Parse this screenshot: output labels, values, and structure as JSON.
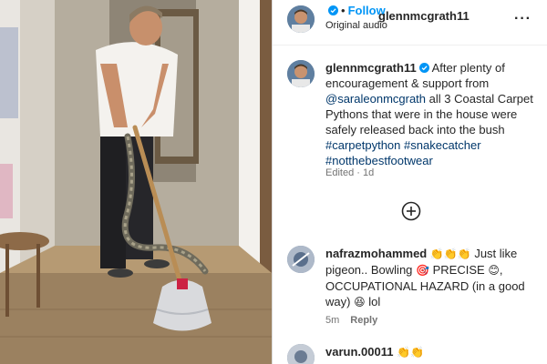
{
  "post": {
    "author": "glennmcgrath11",
    "follow_label": "Follow",
    "dot": "•",
    "audio": "Original audio",
    "more_icon": "more-options-icon",
    "caption": {
      "username": "glennmcgrath11",
      "text_1": "After plenty of encouragement & support from",
      "mention": "@saraleonmcgrath",
      "text_2": "all 3 Coastal Carpet Pythons that were in the house were safely released back into the bush",
      "hashtags": [
        "#carpetpython",
        "#snakecatcher",
        "#notthebestfootwear"
      ]
    },
    "meta": "Edited · 1d"
  },
  "comments": [
    {
      "username": "nafrazmohammed",
      "text_a": "Just like pigeon.. Bowling",
      "text_b": "PRECISE",
      "text_c": ", OCCUPATIONAL HAZARD (in a good way)",
      "text_d": "lol",
      "emoji_clap": "👏👏👏",
      "emoji_target": "🎯",
      "emoji_smile": "😊",
      "emoji_laugh": "😆",
      "time": "5m",
      "reply_label": "Reply"
    },
    {
      "username": "varun.00011",
      "emoji_clap": "👏👏"
    }
  ],
  "colors": {
    "follow": "#0095f6",
    "link": "#00376b",
    "muted": "#737373",
    "verified": "#0095f6"
  }
}
